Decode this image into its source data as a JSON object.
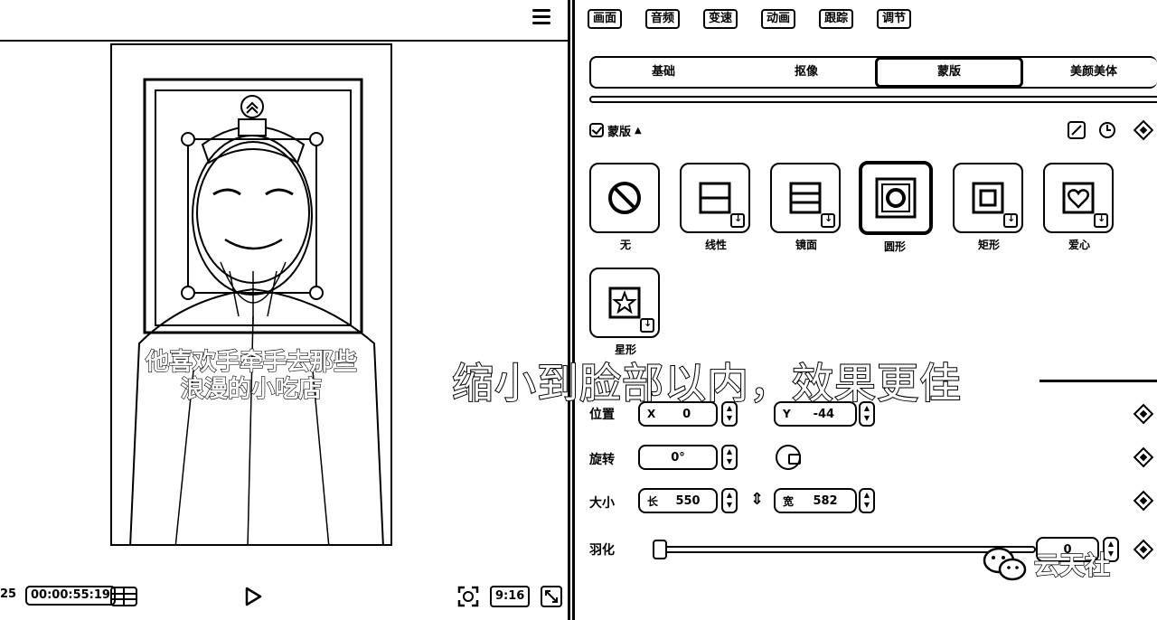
{
  "preview": {
    "subtitle_line1": "他喜欢手牵手去那些",
    "subtitle_line2": "浪漫的小吃店",
    "timecode_prefix": "25",
    "timecode": "00:00:55:19",
    "ratio": "9:16"
  },
  "top_tabs": [
    "画面",
    "音频",
    "变速",
    "动画",
    "跟踪",
    "调节"
  ],
  "sub_tabs": [
    "基础",
    "抠像",
    "蒙版",
    "美颜美体"
  ],
  "active_sub_tab": "蒙版",
  "mask": {
    "header": "蒙版",
    "tiles": [
      {
        "label": "无",
        "icon": "none-icon"
      },
      {
        "label": "线性",
        "icon": "linear-icon"
      },
      {
        "label": "镜面",
        "icon": "mirror-icon"
      },
      {
        "label": "圆形",
        "icon": "circle-icon",
        "selected": true
      },
      {
        "label": "矩形",
        "icon": "rectangle-icon"
      },
      {
        "label": "爱心",
        "icon": "heart-icon"
      },
      {
        "label": "星形",
        "icon": "star-icon"
      }
    ]
  },
  "position": {
    "label": "位置",
    "x_axis": "X",
    "x": "0",
    "y_axis": "Y",
    "y": "-44"
  },
  "rotation": {
    "label": "旋转",
    "value": "0°"
  },
  "size": {
    "label": "大小",
    "length_label": "长",
    "length": "550",
    "width_label": "宽",
    "width": "582"
  },
  "feather": {
    "label": "羽化",
    "value": "0",
    "level": 0
  },
  "overlay_caption": "缩小到脸部以内，效果更佳",
  "watermark": "云天社"
}
